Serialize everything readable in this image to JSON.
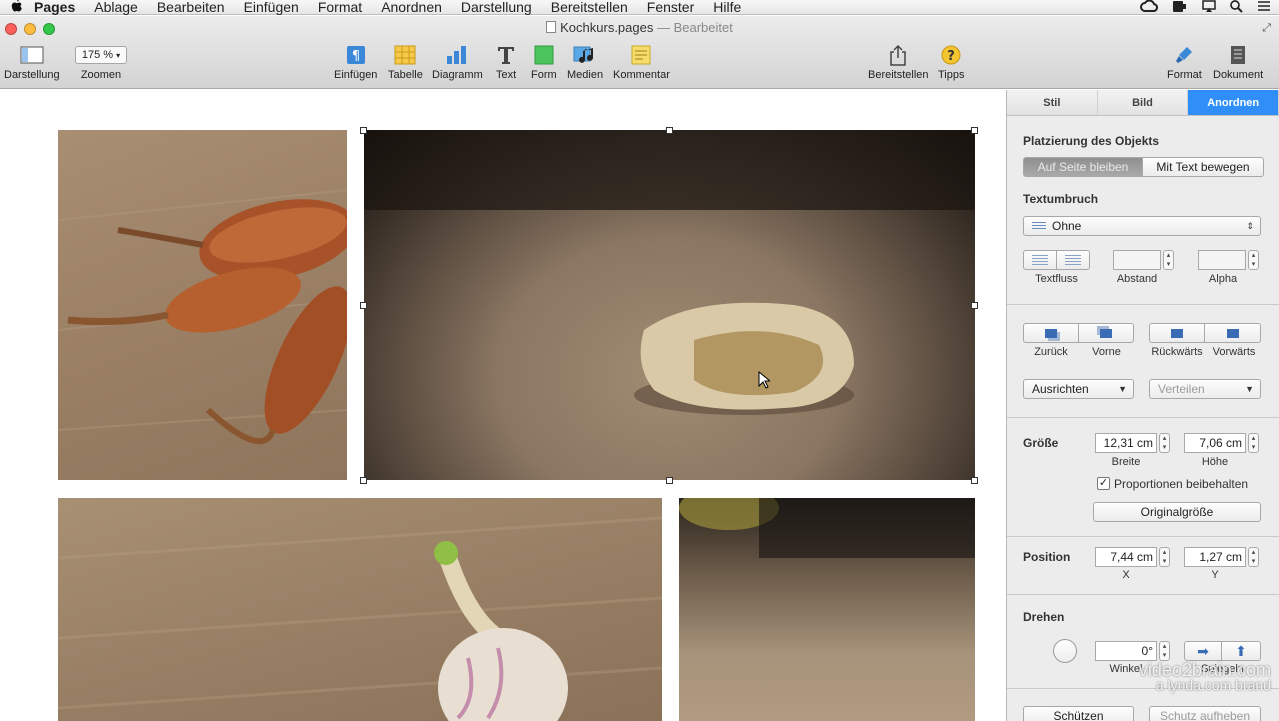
{
  "menubar": {
    "app": "Pages",
    "items": [
      "Ablage",
      "Bearbeiten",
      "Einfügen",
      "Format",
      "Anordnen",
      "Darstellung",
      "Bereitstellen",
      "Fenster",
      "Hilfe"
    ]
  },
  "window": {
    "title": "Kochkurs.pages",
    "edited": "— Bearbeitet"
  },
  "toolbar": {
    "darstellung": "Darstellung",
    "zoom_value": "175 %",
    "zoom_label": "Zoomen",
    "einfuegen": "Einfügen",
    "tabelle": "Tabelle",
    "diagramm": "Diagramm",
    "text": "Text",
    "form": "Form",
    "medien": "Medien",
    "kommentar": "Kommentar",
    "bereitstellen": "Bereitstellen",
    "tipps": "Tipps",
    "format": "Format",
    "dokument": "Dokument"
  },
  "inspector": {
    "tabs": [
      "Stil",
      "Bild",
      "Anordnen"
    ],
    "placement_heading": "Platzierung des Objekts",
    "placement_on_page": "Auf Seite bleiben",
    "placement_with_text": "Mit Text bewegen",
    "wrap_heading": "Textumbruch",
    "wrap_value": "Ohne",
    "textfluss": "Textfluss",
    "abstand": "Abstand",
    "alpha": "Alpha",
    "zurueck": "Zurück",
    "vorne": "Vorne",
    "rueckwaerts": "Rückwärts",
    "vorwaerts": "Vorwärts",
    "ausrichten": "Ausrichten",
    "verteilen": "Verteilen",
    "size_heading": "Größe",
    "width_value": "12,31 cm",
    "width_label": "Breite",
    "height_value": "7,06 cm",
    "height_label": "Höhe",
    "keep_proportions": "Proportionen beibehalten",
    "original_size": "Originalgröße",
    "position_heading": "Position",
    "x_value": "7,44 cm",
    "x_label": "X",
    "y_value": "1,27 cm",
    "y_label": "Y",
    "rotate_heading": "Drehen",
    "angle_value": "0°",
    "angle_label": "Winkel",
    "mirror_label": "Spiegeln",
    "protect": "Schützen",
    "unprotect": "Schutz aufheben"
  },
  "watermark": {
    "line1": "video2brain.com",
    "line2": "a lynda.com brand"
  },
  "colors": {
    "accent": "#2f8ef8"
  }
}
